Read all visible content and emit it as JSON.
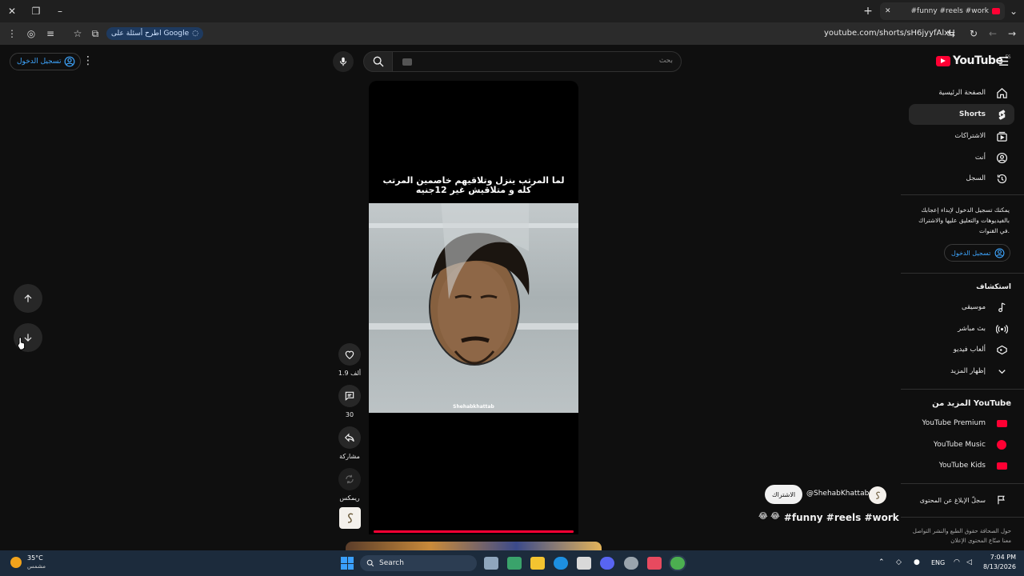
{
  "browser": {
    "tab_title": "#funny #reels #work",
    "new_tab": "+",
    "url": "youtube.com/shorts/sH6jyyfAlxU",
    "google_chip": "اطرح أسئلة على Google"
  },
  "header": {
    "signin_label": "تسجيل الدخول",
    "search_placeholder": "بحث",
    "logo_text": "YouTube",
    "logo_region": "ES"
  },
  "sidebar": {
    "items": [
      {
        "label": "الصفحة الرئيسية",
        "icon": "home-icon"
      },
      {
        "label": "Shorts",
        "icon": "shorts-icon"
      },
      {
        "label": "الاشتراكات",
        "icon": "subscriptions-icon"
      },
      {
        "label": "أنت",
        "icon": "you-icon"
      },
      {
        "label": "السجل",
        "icon": "history-icon"
      }
    ],
    "signin_prompt": "يمكنك تسجيل الدخول لإبداء إعجابك بالفيديوهات والتعليق عليها والاشتراك في القنوات.",
    "signin_button": "تسجيل الدخول",
    "explore_title": "استكشاف",
    "explore_items": [
      {
        "label": "موسيقى",
        "icon": "music-icon"
      },
      {
        "label": "بث مباشر",
        "icon": "live-icon"
      },
      {
        "label": "ألعاب فيديو",
        "icon": "gaming-icon"
      },
      {
        "label": "إظهار المزيد",
        "icon": "chevron-down-icon"
      }
    ],
    "more_title": "المزيد من YouTube",
    "more_items": [
      {
        "label": "YouTube Premium",
        "color": "#ff0033"
      },
      {
        "label": "YouTube Music",
        "color": "#ff0033"
      },
      {
        "label": "YouTube Kids",
        "color": "#ff0033"
      }
    ],
    "report_label": "سجلّ الإبلاغ عن المحتوى",
    "footer": "حول الصحافة حقوق الطبع والنشر التواصل معنا صنّاع المحتوى الإعلان"
  },
  "video": {
    "caption": "لما المرتب ينزل وتلاقيهم خاصمين المرتب كله و متلاقيش غير 12جنيه",
    "watermark": "Shehabkhattab",
    "progress": 1.0
  },
  "actions": {
    "likes": "1.9 ألف",
    "comments": "30",
    "share": "مشاركة",
    "remix": "ريمكس"
  },
  "channel": {
    "handle": "@ShehabKhattab",
    "subscribe": "الاشتراك",
    "title": "#funny #reels #work",
    "emoji": "😂 😂"
  },
  "taskbar": {
    "weather_temp": "35°C",
    "weather_desc": "مشمس",
    "search_label": "Search",
    "language": "ENG",
    "time": "7:04 PM",
    "date": "8/13/2026"
  },
  "colors": {
    "accent": "#ff0033",
    "link": "#3ea6ff"
  }
}
